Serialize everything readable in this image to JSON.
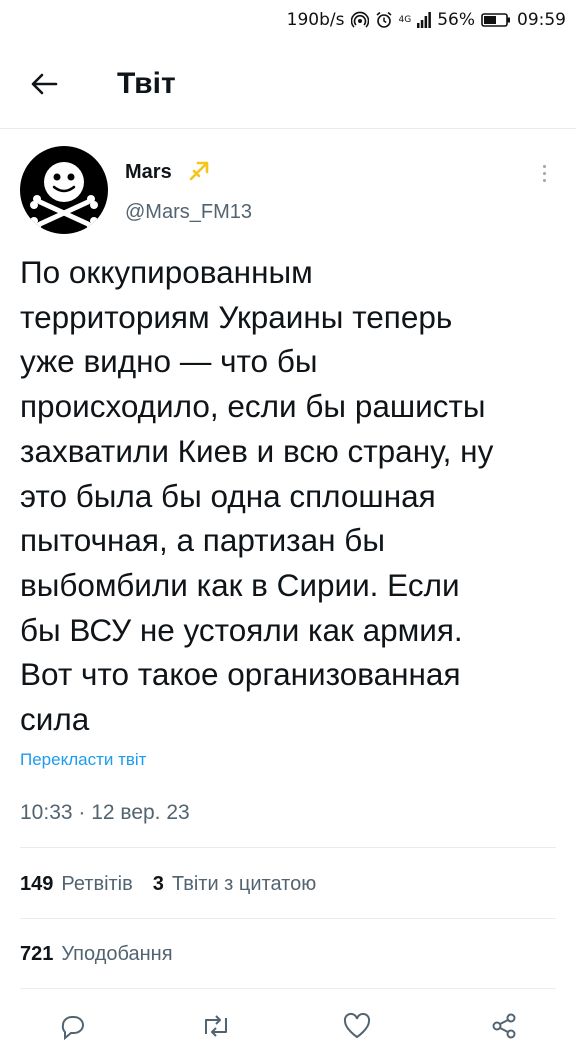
{
  "status_bar": {
    "speed": "190b/s",
    "network": "4G",
    "battery": "56%",
    "time": "09:59"
  },
  "header": {
    "title": "Твіт"
  },
  "tweet": {
    "display_name": "Mars",
    "handle": "@Mars_FM13",
    "text": "По оккупированным\nтерриториям Украины теперь\nуже видно — что бы\nпроисходило, если бы рашисты\nзахватили Киев и всю страну, ну\nэто была бы одна сплошная\nпыточная, а партизан бы\nвыбомбили как в Сирии. Если\nбы ВСУ не устояли как армия.\nВот что такое организованная\nсила",
    "translate_label": "Перекласти твіт",
    "timestamp": "10:33 · 12 вер. 23"
  },
  "stats": {
    "retweets_count": "149",
    "retweets_label": "Ретвітів",
    "quotes_count": "3",
    "quotes_label": "Твіти з цитатою",
    "likes_count": "721",
    "likes_label": "Уподобання"
  },
  "icons": {
    "back": "arrow-left-icon",
    "more": "more-vertical-icon",
    "zodiac": "sagittarius-icon",
    "actions": [
      "reply-icon",
      "retweet-icon",
      "like-icon",
      "share-icon"
    ]
  },
  "colors": {
    "accent": "#1d9bf0",
    "secondary_text": "#536471",
    "zodiac": "#f5c518"
  }
}
